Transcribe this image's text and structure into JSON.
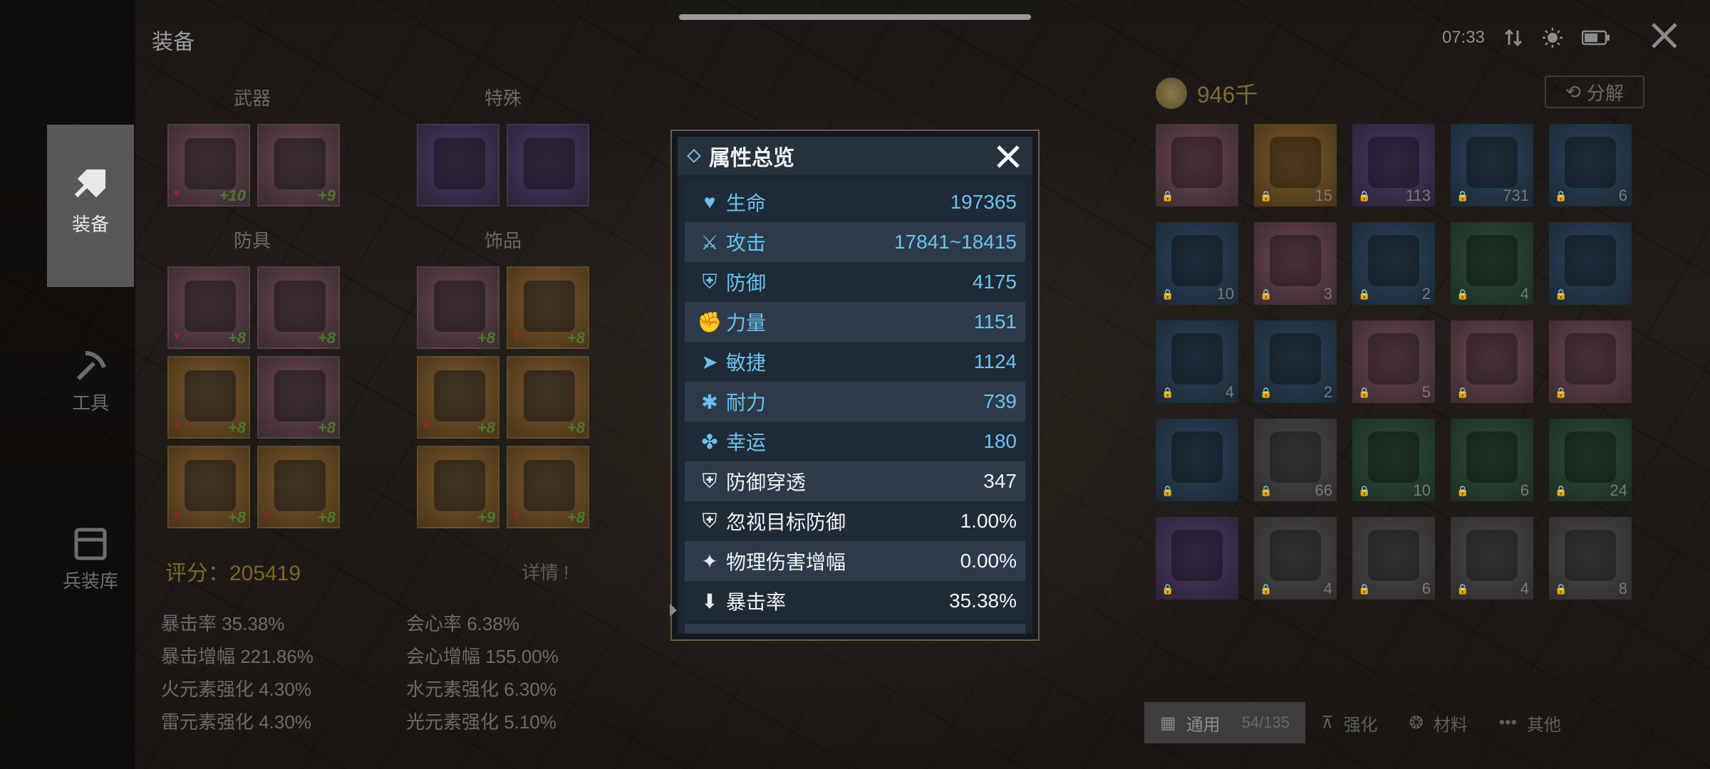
{
  "header": {
    "title": "装备",
    "time": "07:33"
  },
  "nav": [
    {
      "label": "装备",
      "active": true,
      "icon": "armor-icon"
    },
    {
      "label": "工具",
      "active": false,
      "icon": "pickaxe-icon"
    },
    {
      "label": "兵装库",
      "active": false,
      "icon": "storage-icon"
    }
  ],
  "equipment": {
    "sections": {
      "weapon": "武器",
      "special": "特殊",
      "armor": "防具",
      "accessory": "饰品"
    },
    "weapon_slots": [
      {
        "plus": "+10"
      },
      {
        "plus": "+9"
      }
    ],
    "special_slots": [
      {
        "plus": ""
      },
      {
        "plus": ""
      }
    ],
    "armor_slots": [
      {
        "plus": "+8"
      },
      {
        "plus": "+8"
      },
      {
        "plus": "+8"
      },
      {
        "plus": "+8"
      },
      {
        "plus": "+8"
      },
      {
        "plus": "+8"
      }
    ],
    "accessory_slots": [
      {
        "plus": "+8"
      },
      {
        "plus": "+8"
      },
      {
        "plus": "+8"
      },
      {
        "plus": "+8"
      },
      {
        "plus": "+9"
      },
      {
        "plus": "+8"
      }
    ],
    "score_label": "评分：",
    "score_value": "205419",
    "detail_label": "详情",
    "stats": [
      {
        "label": "暴击率 35.38%"
      },
      {
        "label": "会心率 6.38%"
      },
      {
        "label": "暴击增幅 221.86%"
      },
      {
        "label": "会心增幅 155.00%"
      },
      {
        "label": "火元素强化 4.30%"
      },
      {
        "label": "水元素强化 6.30%"
      },
      {
        "label": "雷元素强化 4.30%"
      },
      {
        "label": "光元素强化 5.10%"
      }
    ]
  },
  "inventory": {
    "currency": "946千",
    "decompose_label": "分解",
    "items": [
      {
        "color": "pink",
        "count": ""
      },
      {
        "color": "gold",
        "count": "15"
      },
      {
        "color": "purple",
        "count": "113"
      },
      {
        "color": "blue",
        "count": "731"
      },
      {
        "color": "blue",
        "count": "6"
      },
      {
        "color": "blue",
        "count": "10"
      },
      {
        "color": "pink",
        "count": "3"
      },
      {
        "color": "blue",
        "count": "2"
      },
      {
        "color": "green",
        "count": "4"
      },
      {
        "color": "blue",
        "count": ""
      },
      {
        "color": "blue",
        "count": "4"
      },
      {
        "color": "blue",
        "count": "2"
      },
      {
        "color": "pink",
        "count": "5"
      },
      {
        "color": "pink",
        "count": ""
      },
      {
        "color": "pink",
        "count": ""
      },
      {
        "color": "blue",
        "count": ""
      },
      {
        "color": "grey",
        "count": "66"
      },
      {
        "color": "green",
        "count": "10"
      },
      {
        "color": "green",
        "count": "6"
      },
      {
        "color": "green",
        "count": "24"
      },
      {
        "color": "purple",
        "count": ""
      },
      {
        "color": "grey",
        "count": "4"
      },
      {
        "color": "grey",
        "count": "6"
      },
      {
        "color": "grey",
        "count": "4"
      },
      {
        "color": "grey",
        "count": "8"
      },
      {
        "color": "purple",
        "count": ""
      },
      {
        "color": "green",
        "count": ""
      },
      {
        "color": "pink",
        "count": ""
      },
      {
        "color": "pink",
        "count": ""
      },
      {
        "color": "blue",
        "count": ""
      }
    ],
    "tabs": [
      {
        "label": "通用",
        "sub": "54/135",
        "active": true
      },
      {
        "label": "强化",
        "sub": "",
        "active": false
      },
      {
        "label": "材料",
        "sub": "",
        "active": false
      },
      {
        "label": "其他",
        "sub": "",
        "active": false
      }
    ]
  },
  "modal": {
    "title": "属性总览",
    "rows": [
      {
        "icon": "heart-icon",
        "label": "生命",
        "value": "197365",
        "style": "blue"
      },
      {
        "icon": "sword-icon",
        "label": "攻击",
        "value": "17841~18415",
        "style": "blue"
      },
      {
        "icon": "shield-icon",
        "label": "防御",
        "value": "4175",
        "style": "blue"
      },
      {
        "icon": "strength-icon",
        "label": "力量",
        "value": "1151",
        "style": "blue"
      },
      {
        "icon": "agility-icon",
        "label": "敏捷",
        "value": "1124",
        "style": "blue"
      },
      {
        "icon": "paw-icon",
        "label": "耐力",
        "value": "739",
        "style": "blue"
      },
      {
        "icon": "clover-icon",
        "label": "幸运",
        "value": "180",
        "style": "blue"
      },
      {
        "icon": "shield-break-icon",
        "label": "防御穿透",
        "value": "347",
        "style": "white"
      },
      {
        "icon": "shield-ignore-icon",
        "label": "忽视目标防御",
        "value": "1.00%",
        "style": "white"
      },
      {
        "icon": "damage-boost-icon",
        "label": "物理伤害增幅",
        "value": "0.00%",
        "style": "white"
      },
      {
        "icon": "crit-icon",
        "label": "暴击率",
        "value": "35.38%",
        "style": "white"
      }
    ]
  },
  "colors": {
    "stat_blue": "#69c2f0",
    "score_gold": "#7a6526",
    "modal_border": "#6b5b48"
  }
}
